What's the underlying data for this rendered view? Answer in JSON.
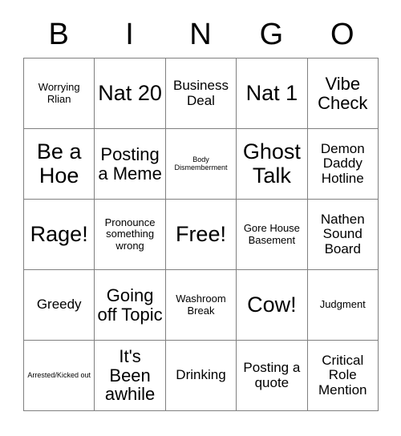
{
  "card": {
    "header_letters": [
      "B",
      "I",
      "N",
      "G",
      "O"
    ],
    "rows": [
      [
        {
          "text": "Worrying Rlian",
          "size": "sm"
        },
        {
          "text": "Nat 20",
          "size": "xl"
        },
        {
          "text": "Business Deal",
          "size": "md"
        },
        {
          "text": "Nat 1",
          "size": "xl"
        },
        {
          "text": "Vibe Check",
          "size": "lg"
        }
      ],
      [
        {
          "text": "Be a Hoe",
          "size": "xl"
        },
        {
          "text": "Posting a Meme",
          "size": "lg"
        },
        {
          "text": "Body Dismemberment",
          "size": "xs"
        },
        {
          "text": "Ghost Talk",
          "size": "xl"
        },
        {
          "text": "Demon Daddy Hotline",
          "size": "md"
        }
      ],
      [
        {
          "text": "Rage!",
          "size": "xl"
        },
        {
          "text": "Pronounce something wrong",
          "size": "sm"
        },
        {
          "text": "Free!",
          "size": "xl"
        },
        {
          "text": "Gore House Basement",
          "size": "sm"
        },
        {
          "text": "Nathen Sound Board",
          "size": "md"
        }
      ],
      [
        {
          "text": "Greedy",
          "size": "md"
        },
        {
          "text": "Going off Topic",
          "size": "lg"
        },
        {
          "text": "Washroom Break",
          "size": "sm"
        },
        {
          "text": "Cow!",
          "size": "xl"
        },
        {
          "text": "Judgment",
          "size": "sm"
        }
      ],
      [
        {
          "text": "Arrested/Kicked out",
          "size": "xs"
        },
        {
          "text": "It's Been awhile",
          "size": "lg"
        },
        {
          "text": "Drinking",
          "size": "md"
        },
        {
          "text": "Posting a quote",
          "size": "md"
        },
        {
          "text": "Critical Role Mention",
          "size": "md"
        }
      ]
    ]
  },
  "colors": {
    "background": "#ffffff",
    "text": "#000000",
    "grid_line": "#808080"
  }
}
